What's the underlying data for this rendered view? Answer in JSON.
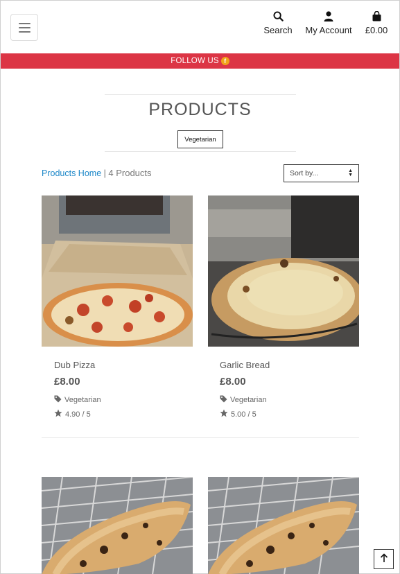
{
  "header": {
    "nav": {
      "search_label": "Search",
      "account_label": "My Account",
      "bag_total": "£0.00"
    }
  },
  "banner": {
    "follow_label": "FOLLOW US",
    "follow_icon": "facebook-icon",
    "color": "#dc3545"
  },
  "page": {
    "title": "PRODUCTS",
    "category_badge": "Vegetarian",
    "breadcrumb_home": "Products Home",
    "breadcrumb_separator": "|",
    "product_count": "4 Products",
    "sort_placeholder": "Sort by..."
  },
  "products": [
    {
      "name": "Dub Pizza",
      "price": "£8.00",
      "category": "Vegetarian",
      "rating": "4.90 / 5"
    },
    {
      "name": "Garlic Bread",
      "price": "£8.00",
      "category": "Vegetarian",
      "rating": "5.00 / 5"
    },
    {
      "name": "",
      "price": "",
      "category": "",
      "rating": ""
    },
    {
      "name": "",
      "price": "",
      "category": "",
      "rating": ""
    }
  ],
  "colors": {
    "link": "#1e88c9",
    "accent": "#dc3545",
    "text": "#555555"
  }
}
